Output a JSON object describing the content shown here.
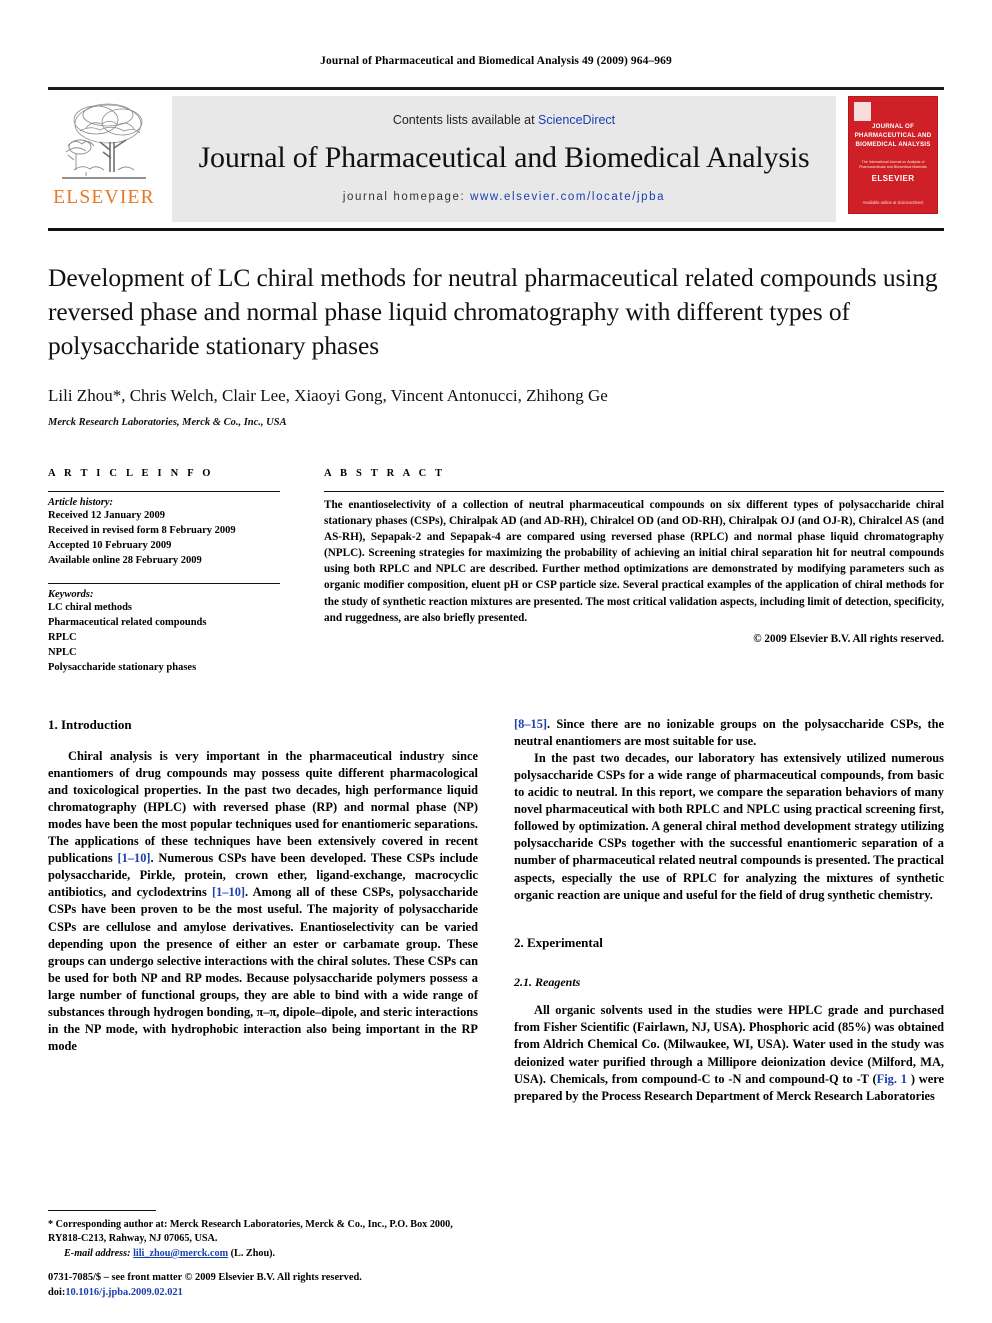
{
  "running_head": "Journal of Pharmaceutical and Biomedical Analysis 49 (2009) 964–969",
  "masthead": {
    "publisher_word": "ELSEVIER",
    "contents_prefix": "Contents lists available at ",
    "contents_link": "ScienceDirect",
    "journal_name": "Journal of Pharmaceutical and Biomedical Analysis",
    "homepage_prefix": "journal homepage: ",
    "homepage_url": "www.elsevier.com/locate/jpba"
  },
  "cover": {
    "title": "JOURNAL OF PHARMACEUTICAL AND BIOMEDICAL ANALYSIS",
    "subtitle": "The International Journal on Analysis of Pharmaceuticals and Biomedical Materials",
    "mark": "ELSEVIER",
    "footer": "Available online at ScienceDirect"
  },
  "article": {
    "title": "Development of LC chiral methods for neutral pharmaceutical related compounds using reversed phase and normal phase liquid chromatography with different types of polysaccharide stationary phases",
    "authors": "Lili Zhou*, Chris Welch, Clair Lee, Xiaoyi Gong, Vincent Antonucci, Zhihong Ge",
    "affiliation": "Merck Research Laboratories, Merck & Co., Inc., USA"
  },
  "info": {
    "heading": "A R T I C L E   I N F O",
    "history_label": "Article history:",
    "history": [
      "Received 12 January 2009",
      "Received in revised form 8 February 2009",
      "Accepted 10 February 2009",
      "Available online 28 February 2009"
    ],
    "keywords_label": "Keywords:",
    "keywords": [
      "LC chiral methods",
      "Pharmaceutical related compounds",
      "RPLC",
      "NPLC",
      "Polysaccharide stationary phases"
    ]
  },
  "abstract": {
    "heading": "A B S T R A C T",
    "text": "The enantioselectivity of a collection of neutral pharmaceutical compounds on six different types of polysaccharide chiral stationary phases (CSPs), Chiralpak AD (and AD-RH), Chiralcel OD (and OD-RH), Chiralpak OJ (and OJ-R), Chiralcel AS (and AS-RH), Sepapak-2 and Sepapak-4 are compared using reversed phase (RPLC) and normal phase liquid chromatography (NPLC). Screening strategies for maximizing the probability of achieving an initial chiral separation hit for neutral compounds using both RPLC and NPLC are described. Further method optimizations are demonstrated by modifying parameters such as organic modifier composition, eluent pH or CSP particle size. Several practical examples of the application of chiral methods for the study of synthetic reaction mixtures are presented. The most critical validation aspects, including limit of detection, specificity, and ruggedness, are also briefly presented.",
    "copyright": "© 2009 Elsevier B.V. All rights reserved."
  },
  "sections": {
    "intro_heading": "1. Introduction",
    "intro_p1_a": "Chiral analysis is very important in the pharmaceutical industry since enantiomers of drug compounds may possess quite different pharmacological and toxicological properties. In the past two decades, high performance liquid chromatography (HPLC) with reversed phase (RP) and normal phase (NP) modes have been the most popular techniques used for enantiomeric separations. The applications of these techniques have been extensively covered in recent publications ",
    "intro_ref1": "[1–10]",
    "intro_p1_b": ". Numerous CSPs have been developed. These CSPs include polysaccharide, Pirkle, protein, crown ether, ligand-exchange, macrocyclic antibiotics, and cyclodextrins ",
    "intro_ref2": "[1–10]",
    "intro_p1_c": ". Among all of these CSPs, polysaccharide CSPs have been proven to be the most useful. The majority of polysaccharide CSPs are cellulose and amylose derivatives. Enantioselectivity can be varied depending upon the presence of either an ester or carbamate group. These groups can undergo selective interactions with the chiral solutes. These CSPs can be used for both NP and RP modes. Because polysaccharide polymers possess a large number of functional groups, they are able to bind with a wide range of substances through hydrogen bonding, π–π, dipole–dipole, and steric interactions in the NP mode, with hydrophobic interaction also being important in the RP mode ",
    "intro_ref3": "[8–15]",
    "intro_p1_d": ". Since there are no ionizable groups on the polysaccharide CSPs, the neutral enantiomers are most suitable for use.",
    "intro_p2": "In the past two decades, our laboratory has extensively utilized numerous polysaccharide CSPs for a wide range of pharmaceutical compounds, from basic to acidic to neutral. In this report, we compare the separation behaviors of many novel pharmaceutical with both RPLC and NPLC using practical screening first, followed by optimization. A general chiral method development strategy utilizing polysaccharide CSPs together with the successful enantiomeric separation of a number of pharmaceutical related neutral compounds is presented. The practical aspects, especially the use of RPLC for analyzing the mixtures of synthetic organic reaction are unique and useful for the field of drug synthetic chemistry.",
    "exp_heading": "2. Experimental",
    "reagents_heading": "2.1. Reagents",
    "reagents_a": "All organic solvents used in the studies were HPLC grade and purchased from Fisher Scientific (Fairlawn, NJ, USA). Phosphoric acid (85%) was obtained from Aldrich Chemical Co. (Milwaukee, WI, USA). Water used in the study was deionized water purified through a Millipore deionization device (Milford, MA, USA). Chemicals, from compound-C to -N and compound-Q to -T (",
    "reagents_figref": "Fig. 1",
    "reagents_b": " ) were prepared by the Process Research Department of Merck Research Laboratories"
  },
  "footnotes": {
    "corresponding": "*  Corresponding author at: Merck Research Laboratories, Merck & Co., Inc., P.O. Box 2000, RY818-C213, Rahway, NJ 07065, USA.",
    "email_label": "E-mail address:",
    "email": "lili_zhou@merck.com",
    "email_suffix": " (L. Zhou)."
  },
  "imprint": {
    "front_matter": "0731-7085/$ – see front matter © 2009 Elsevier B.V. All rights reserved.",
    "doi_label": "doi:",
    "doi": "10.1016/j.jpba.2009.02.021"
  },
  "colors": {
    "link_blue": "#1a3fb0",
    "elsevier_orange": "#e87722",
    "cover_red": "#cf2027",
    "band_grey": "#e8e8e8"
  }
}
